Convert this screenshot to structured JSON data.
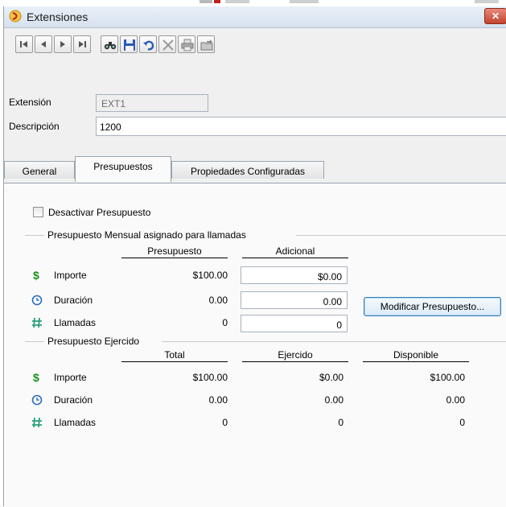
{
  "window": {
    "title": "Extensiones",
    "close_symbol": "✕"
  },
  "toolbar": {
    "buttons": [
      {
        "name": "first-record",
        "icon": "first-record-icon"
      },
      {
        "name": "previous-record",
        "icon": "previous-record-icon"
      },
      {
        "name": "next-record",
        "icon": "next-record-icon"
      },
      {
        "name": "last-record",
        "icon": "last-record-icon"
      },
      {
        "name": "search",
        "icon": "binoculars-icon"
      },
      {
        "name": "save",
        "icon": "floppy-disk-icon"
      },
      {
        "name": "undo",
        "icon": "undo-icon"
      },
      {
        "name": "delete",
        "icon": "delete-x-icon"
      },
      {
        "name": "print",
        "icon": "printer-icon"
      },
      {
        "name": "export",
        "icon": "folder-export-icon"
      }
    ]
  },
  "form": {
    "extension_label": "Extensión",
    "extension_value": "EXT1",
    "description_label": "Descripción",
    "description_value": "1200"
  },
  "tabs": [
    {
      "label": "General",
      "active": false
    },
    {
      "label": "Presupuestos",
      "active": true
    },
    {
      "label": "Propiedades Configuradas",
      "active": false
    }
  ],
  "budget": {
    "deactivate_label": "Desactivar Presupuesto",
    "deactivate_checked": false,
    "monthly": {
      "group_title": "Presupuesto Mensual asignado para llamadas",
      "col_budget": "Presupuesto",
      "col_additional": "Adicional",
      "rows": [
        {
          "icon": "dollar-icon",
          "label": "Importe",
          "budget": "$100.00",
          "additional": "$0.00"
        },
        {
          "icon": "clock-icon",
          "label": "Duración",
          "budget": "0.00",
          "additional": "0.00"
        },
        {
          "icon": "hash-icon",
          "label": "Llamadas",
          "budget": "0",
          "additional": "0"
        }
      ],
      "modify_button": "Modificar Presupuesto..."
    },
    "spent": {
      "group_title": "Presupuesto Ejercido",
      "col_total": "Total",
      "col_spent": "Ejercido",
      "col_available": "Disponible",
      "rows": [
        {
          "icon": "dollar-icon",
          "label": "Importe",
          "total": "$100.00",
          "spent": "$0.00",
          "available": "$100.00"
        },
        {
          "icon": "clock-icon",
          "label": "Duración",
          "total": "0.00",
          "spent": "0.00",
          "available": "0.00"
        },
        {
          "icon": "hash-icon",
          "label": "Llamadas",
          "total": "0",
          "spent": "0",
          "available": "0"
        }
      ]
    }
  },
  "colors": {
    "dollar": "#1a8f1a",
    "clock": "#2a6fc0",
    "hash": "#2aa07a",
    "titlebar": "#d6e1ee"
  }
}
